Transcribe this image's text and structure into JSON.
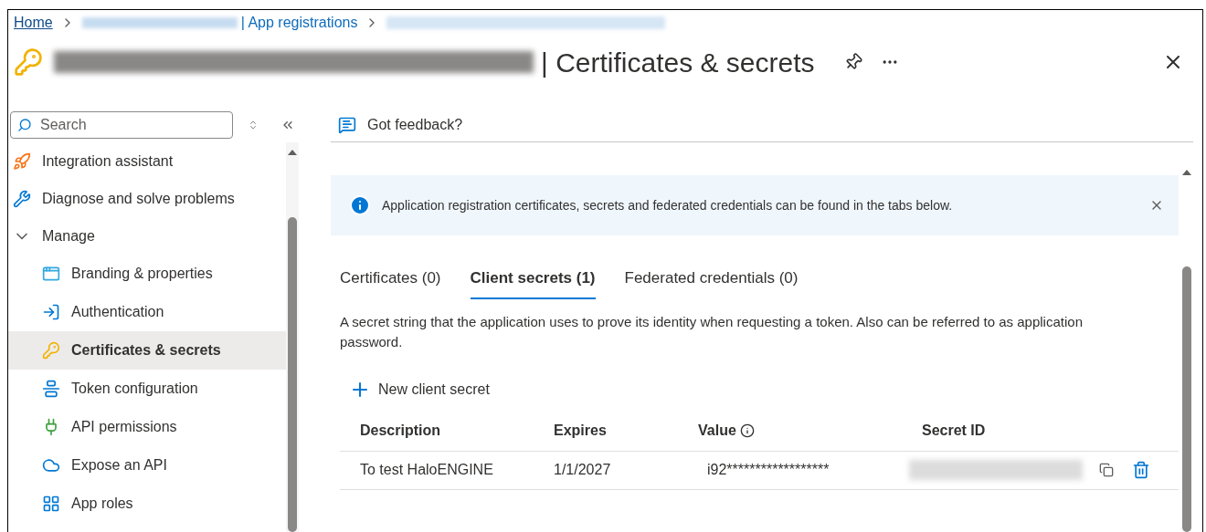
{
  "breadcrumb": {
    "home": "Home",
    "section": "| App registrations"
  },
  "title": "| Certificates & secrets",
  "sidebar": {
    "search": {
      "placeholder": "Search"
    },
    "items": [
      {
        "label": "Integration assistant",
        "selected": false
      },
      {
        "label": "Diagnose and solve problems",
        "selected": false
      },
      {
        "label": "Manage",
        "selected": false,
        "expanded": true,
        "children": [
          {
            "label": "Branding & properties",
            "selected": false
          },
          {
            "label": "Authentication",
            "selected": false
          },
          {
            "label": "Certificates & secrets",
            "selected": true
          },
          {
            "label": "Token configuration",
            "selected": false
          },
          {
            "label": "API permissions",
            "selected": false
          },
          {
            "label": "Expose an API",
            "selected": false
          },
          {
            "label": "App roles",
            "selected": false
          }
        ]
      }
    ]
  },
  "toolbar": {
    "feedback": "Got feedback?"
  },
  "banner": {
    "text": "Application registration certificates, secrets and federated credentials can be found in the tabs below."
  },
  "tabs": [
    {
      "label": "Certificates (0)",
      "selected": false
    },
    {
      "label": "Client secrets (1)",
      "selected": true
    },
    {
      "label": "Federated credentials (0)",
      "selected": false
    }
  ],
  "description": "A secret string that the application uses to prove its identity when requesting a token. Also can be referred to as application password.",
  "new_button": "New client secret",
  "table": {
    "columns": [
      "Description",
      "Expires",
      "Value",
      "Secret ID"
    ],
    "rows": [
      {
        "description": "To test HaloENGINE",
        "expires": "1/1/2027",
        "value": "i92******************"
      }
    ]
  }
}
